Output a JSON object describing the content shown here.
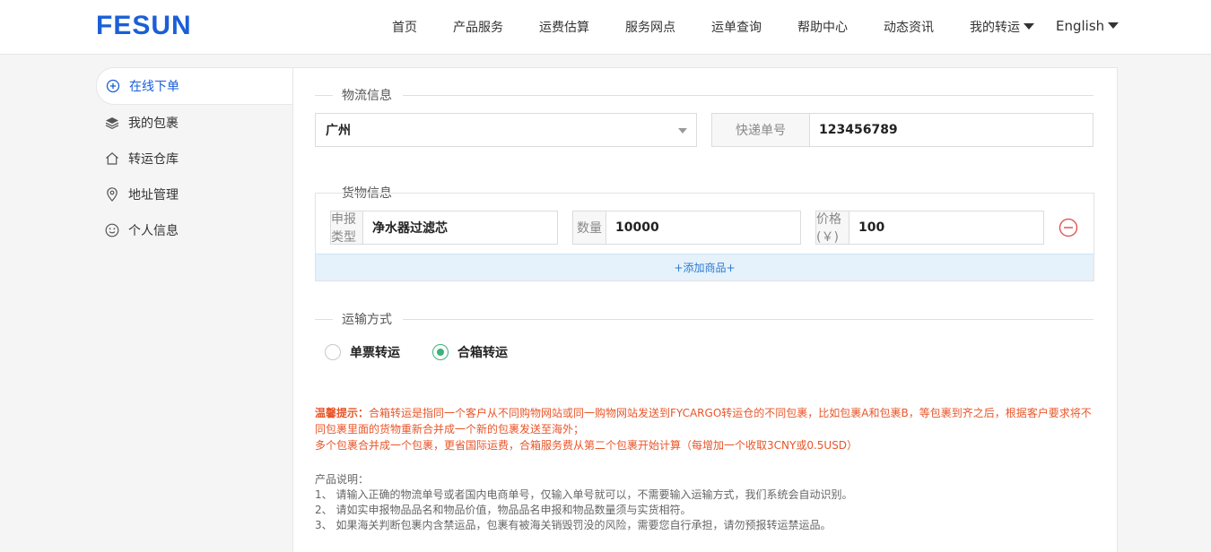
{
  "header": {
    "logo": "FESUN",
    "nav": [
      {
        "label": "首页"
      },
      {
        "label": "产品服务"
      },
      {
        "label": "运费估算"
      },
      {
        "label": "服务网点"
      },
      {
        "label": "运单查询"
      },
      {
        "label": "帮助中心"
      },
      {
        "label": "动态资讯"
      },
      {
        "label": "我的转运"
      }
    ],
    "language": "English"
  },
  "sidebar": {
    "items": [
      {
        "label": "在线下单",
        "icon": "plus-circle-icon",
        "active": true
      },
      {
        "label": "我的包裹",
        "icon": "layers-icon"
      },
      {
        "label": "转运仓库",
        "icon": "home-icon"
      },
      {
        "label": "地址管理",
        "icon": "location-pin-icon"
      },
      {
        "label": "个人信息",
        "icon": "smiley-icon"
      }
    ]
  },
  "logistics": {
    "title": "物流信息",
    "city": "广州",
    "tracking_label": "快递单号",
    "tracking_value": "123456789"
  },
  "goods": {
    "title": "货物信息",
    "type_label": "申报类型",
    "type_value": "净水器过滤芯",
    "qty_label": "数量",
    "qty_value": "10000",
    "price_label": "价格(￥)",
    "price_value": "100",
    "add_label": "+添加商品+"
  },
  "shipping": {
    "title": "运输方式",
    "options": [
      {
        "label": "单票转运",
        "checked": false
      },
      {
        "label": "合箱转运",
        "checked": true
      }
    ]
  },
  "tip": {
    "prefix": "温馨提示：",
    "line1": "合箱转运是指同一个客户从不同购物网站或同一购物网站发送到FYCARGO转运仓的不同包裹，比如包裹A和包裹B，等包裹到齐之后，根据客户要求将不同包裹里面的货物重新合并成一个新的包裹发送至海外；",
    "line2": "多个包裹合并成一个包裹，更省国际运费，合箱服务费从第二个包裹开始计算（每增加一个收取3CNY或0.5USD）"
  },
  "desc": {
    "title": "产品说明：",
    "items": [
      "1、 请输入正确的物流单号或者国内电商单号，仅输入单号就可以，不需要输入运输方式，我们系统会自动识别。",
      "2、 请如实申报物品品名和物品价值，物品品名申报和物品数量须与实货相符。",
      "3、 如果海关判断包裹内含禁运品，包裹有被海关销毁罚没的风险，需要您自行承担，请勿预报转运禁运品。"
    ]
  },
  "colors": {
    "brand": "#1a5fd6",
    "tip": "#e8562a",
    "radio_checked": "#3bb37a",
    "remove": "#e04848"
  }
}
